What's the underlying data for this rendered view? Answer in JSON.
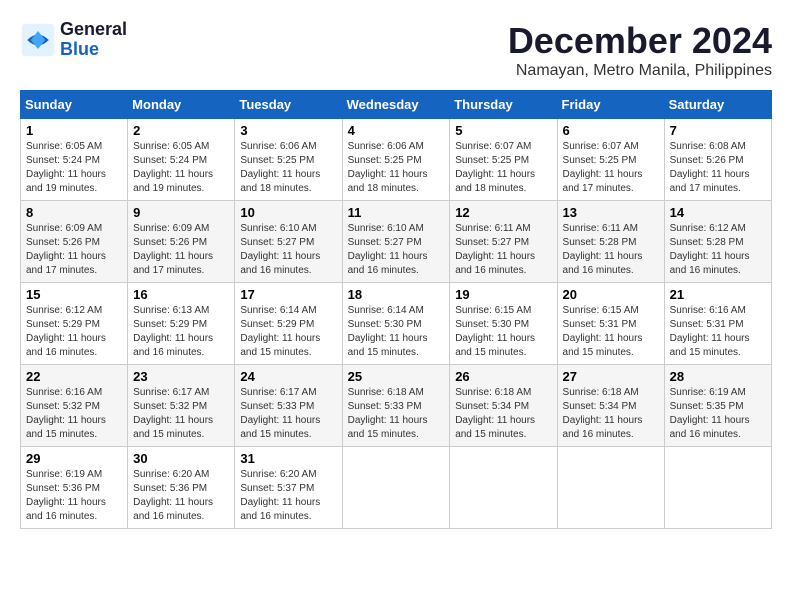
{
  "logo": {
    "line1": "General",
    "line2": "Blue"
  },
  "title": "December 2024",
  "location": "Namayan, Metro Manila, Philippines",
  "days_of_week": [
    "Sunday",
    "Monday",
    "Tuesday",
    "Wednesday",
    "Thursday",
    "Friday",
    "Saturday"
  ],
  "weeks": [
    [
      {
        "day": "1",
        "sunrise": "6:05 AM",
        "sunset": "5:24 PM",
        "daylight": "11 hours and 19 minutes."
      },
      {
        "day": "2",
        "sunrise": "6:05 AM",
        "sunset": "5:24 PM",
        "daylight": "11 hours and 19 minutes."
      },
      {
        "day": "3",
        "sunrise": "6:06 AM",
        "sunset": "5:25 PM",
        "daylight": "11 hours and 18 minutes."
      },
      {
        "day": "4",
        "sunrise": "6:06 AM",
        "sunset": "5:25 PM",
        "daylight": "11 hours and 18 minutes."
      },
      {
        "day": "5",
        "sunrise": "6:07 AM",
        "sunset": "5:25 PM",
        "daylight": "11 hours and 18 minutes."
      },
      {
        "day": "6",
        "sunrise": "6:07 AM",
        "sunset": "5:25 PM",
        "daylight": "11 hours and 17 minutes."
      },
      {
        "day": "7",
        "sunrise": "6:08 AM",
        "sunset": "5:26 PM",
        "daylight": "11 hours and 17 minutes."
      }
    ],
    [
      {
        "day": "8",
        "sunrise": "6:09 AM",
        "sunset": "5:26 PM",
        "daylight": "11 hours and 17 minutes."
      },
      {
        "day": "9",
        "sunrise": "6:09 AM",
        "sunset": "5:26 PM",
        "daylight": "11 hours and 17 minutes."
      },
      {
        "day": "10",
        "sunrise": "6:10 AM",
        "sunset": "5:27 PM",
        "daylight": "11 hours and 16 minutes."
      },
      {
        "day": "11",
        "sunrise": "6:10 AM",
        "sunset": "5:27 PM",
        "daylight": "11 hours and 16 minutes."
      },
      {
        "day": "12",
        "sunrise": "6:11 AM",
        "sunset": "5:27 PM",
        "daylight": "11 hours and 16 minutes."
      },
      {
        "day": "13",
        "sunrise": "6:11 AM",
        "sunset": "5:28 PM",
        "daylight": "11 hours and 16 minutes."
      },
      {
        "day": "14",
        "sunrise": "6:12 AM",
        "sunset": "5:28 PM",
        "daylight": "11 hours and 16 minutes."
      }
    ],
    [
      {
        "day": "15",
        "sunrise": "6:12 AM",
        "sunset": "5:29 PM",
        "daylight": "11 hours and 16 minutes."
      },
      {
        "day": "16",
        "sunrise": "6:13 AM",
        "sunset": "5:29 PM",
        "daylight": "11 hours and 16 minutes."
      },
      {
        "day": "17",
        "sunrise": "6:14 AM",
        "sunset": "5:29 PM",
        "daylight": "11 hours and 15 minutes."
      },
      {
        "day": "18",
        "sunrise": "6:14 AM",
        "sunset": "5:30 PM",
        "daylight": "11 hours and 15 minutes."
      },
      {
        "day": "19",
        "sunrise": "6:15 AM",
        "sunset": "5:30 PM",
        "daylight": "11 hours and 15 minutes."
      },
      {
        "day": "20",
        "sunrise": "6:15 AM",
        "sunset": "5:31 PM",
        "daylight": "11 hours and 15 minutes."
      },
      {
        "day": "21",
        "sunrise": "6:16 AM",
        "sunset": "5:31 PM",
        "daylight": "11 hours and 15 minutes."
      }
    ],
    [
      {
        "day": "22",
        "sunrise": "6:16 AM",
        "sunset": "5:32 PM",
        "daylight": "11 hours and 15 minutes."
      },
      {
        "day": "23",
        "sunrise": "6:17 AM",
        "sunset": "5:32 PM",
        "daylight": "11 hours and 15 minutes."
      },
      {
        "day": "24",
        "sunrise": "6:17 AM",
        "sunset": "5:33 PM",
        "daylight": "11 hours and 15 minutes."
      },
      {
        "day": "25",
        "sunrise": "6:18 AM",
        "sunset": "5:33 PM",
        "daylight": "11 hours and 15 minutes."
      },
      {
        "day": "26",
        "sunrise": "6:18 AM",
        "sunset": "5:34 PM",
        "daylight": "11 hours and 15 minutes."
      },
      {
        "day": "27",
        "sunrise": "6:18 AM",
        "sunset": "5:34 PM",
        "daylight": "11 hours and 16 minutes."
      },
      {
        "day": "28",
        "sunrise": "6:19 AM",
        "sunset": "5:35 PM",
        "daylight": "11 hours and 16 minutes."
      }
    ],
    [
      {
        "day": "29",
        "sunrise": "6:19 AM",
        "sunset": "5:36 PM",
        "daylight": "11 hours and 16 minutes."
      },
      {
        "day": "30",
        "sunrise": "6:20 AM",
        "sunset": "5:36 PM",
        "daylight": "11 hours and 16 minutes."
      },
      {
        "day": "31",
        "sunrise": "6:20 AM",
        "sunset": "5:37 PM",
        "daylight": "11 hours and 16 minutes."
      },
      null,
      null,
      null,
      null
    ]
  ]
}
